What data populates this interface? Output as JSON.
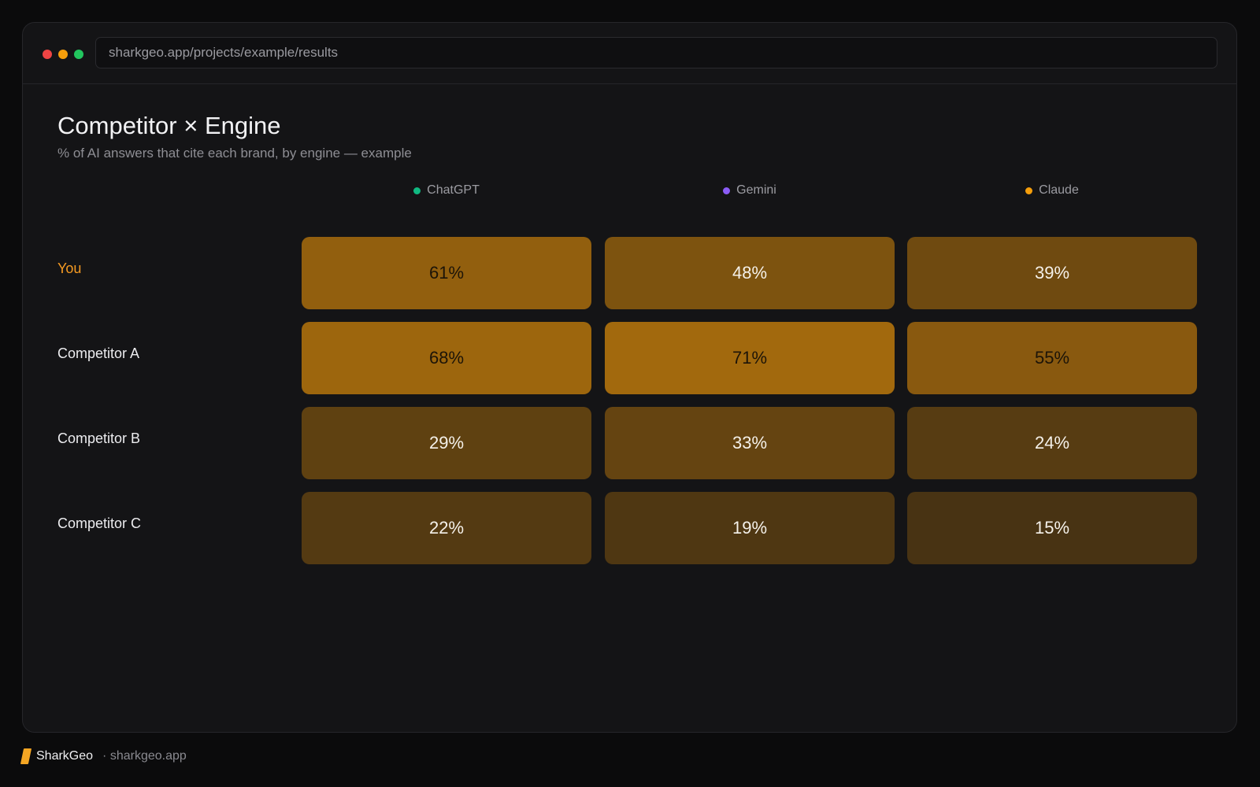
{
  "window": {
    "url": "sharkgeo.app/projects/example/results",
    "traffic_lights": [
      "#ef4444",
      "#f59e0b",
      "#22c55e"
    ]
  },
  "page": {
    "title": "Competitor × Engine",
    "subtitle": "% of AI answers that cite each brand, by engine — example"
  },
  "engines": [
    {
      "label": "ChatGPT",
      "color": "#10b981"
    },
    {
      "label": "Gemini",
      "color": "#8b5cf6"
    },
    {
      "label": "Claude",
      "color": "#f59e0b"
    }
  ],
  "rows": [
    {
      "label": "You",
      "highlight": true,
      "values": [
        "61%",
        "48%",
        "39%"
      ],
      "pct": [
        61,
        48,
        39
      ]
    },
    {
      "label": "Competitor A",
      "highlight": false,
      "values": [
        "68%",
        "71%",
        "55%"
      ],
      "pct": [
        68,
        71,
        55
      ]
    },
    {
      "label": "Competitor B",
      "highlight": false,
      "values": [
        "29%",
        "33%",
        "24%"
      ],
      "pct": [
        29,
        33,
        24
      ]
    },
    {
      "label": "Competitor C",
      "highlight": false,
      "values": [
        "22%",
        "19%",
        "15%"
      ],
      "pct": [
        22,
        19,
        15
      ]
    }
  ],
  "footer": {
    "brand": "SharkGeo",
    "site": "· sharkgeo.app"
  },
  "colors": {
    "accent": "#f59a22"
  }
}
